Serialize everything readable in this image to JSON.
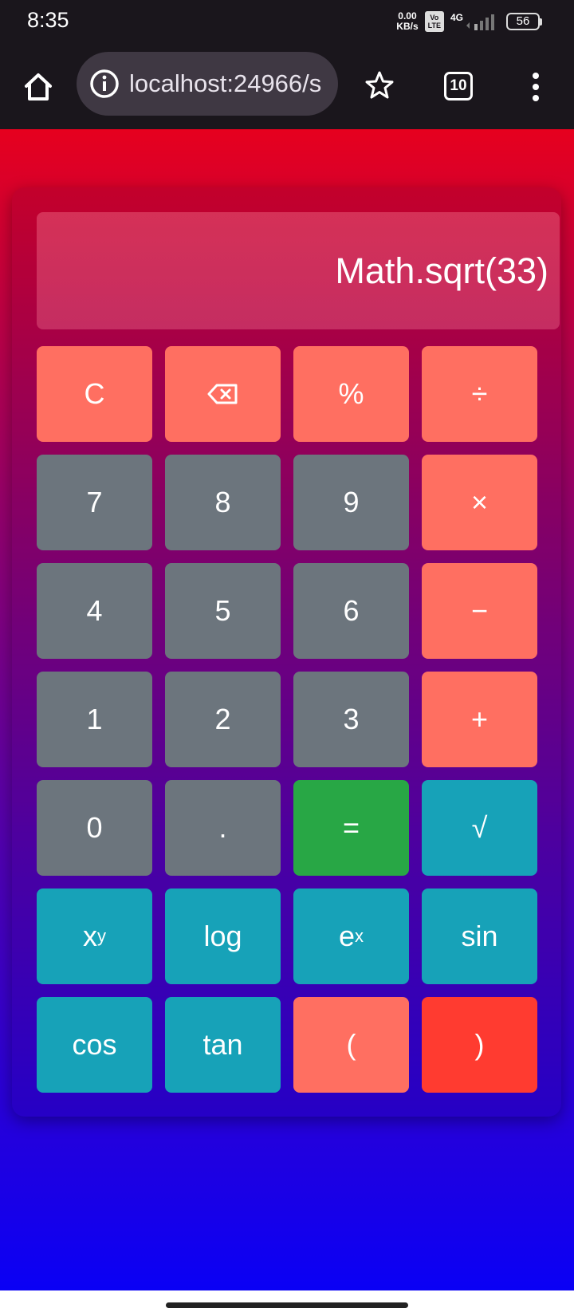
{
  "status_bar": {
    "time": "8:35",
    "net_speed_value": "0.00",
    "net_speed_unit": "KB/s",
    "volte_line1": "Vo",
    "volte_line2": "LTE",
    "network_type": "4G",
    "battery_level": "56"
  },
  "browser": {
    "url": "localhost:24966/s",
    "tab_count": "10"
  },
  "calculator": {
    "display": "Math.sqrt(33)",
    "keys": [
      {
        "label": "C",
        "kind": "op"
      },
      {
        "label": "backspace",
        "kind": "op",
        "icon": "backspace-icon"
      },
      {
        "label": "%",
        "kind": "op"
      },
      {
        "label": "÷",
        "kind": "op"
      },
      {
        "label": "7",
        "kind": "num"
      },
      {
        "label": "8",
        "kind": "num"
      },
      {
        "label": "9",
        "kind": "num"
      },
      {
        "label": "×",
        "kind": "op"
      },
      {
        "label": "4",
        "kind": "num"
      },
      {
        "label": "5",
        "kind": "num"
      },
      {
        "label": "6",
        "kind": "num"
      },
      {
        "label": "−",
        "kind": "op"
      },
      {
        "label": "1",
        "kind": "num"
      },
      {
        "label": "2",
        "kind": "num"
      },
      {
        "label": "3",
        "kind": "num"
      },
      {
        "label": "+",
        "kind": "op"
      },
      {
        "label": "0",
        "kind": "num"
      },
      {
        "label": ".",
        "kind": "num"
      },
      {
        "label": "=",
        "kind": "eq"
      },
      {
        "label": "√",
        "kind": "fn"
      },
      {
        "label": "x",
        "sup": "y",
        "kind": "fn"
      },
      {
        "label": "log",
        "kind": "fn"
      },
      {
        "label": "e",
        "sup": "x",
        "kind": "fn"
      },
      {
        "label": "sin",
        "kind": "fn"
      },
      {
        "label": "cos",
        "kind": "fn"
      },
      {
        "label": "tan",
        "kind": "fn"
      },
      {
        "label": "(",
        "kind": "op"
      },
      {
        "label": ")",
        "kind": "close"
      }
    ],
    "colors": {
      "op": "#ff6f61",
      "num": "#6c757d",
      "eq": "#28a745",
      "fn": "#17a2b8",
      "close": "#ff3b30"
    }
  }
}
